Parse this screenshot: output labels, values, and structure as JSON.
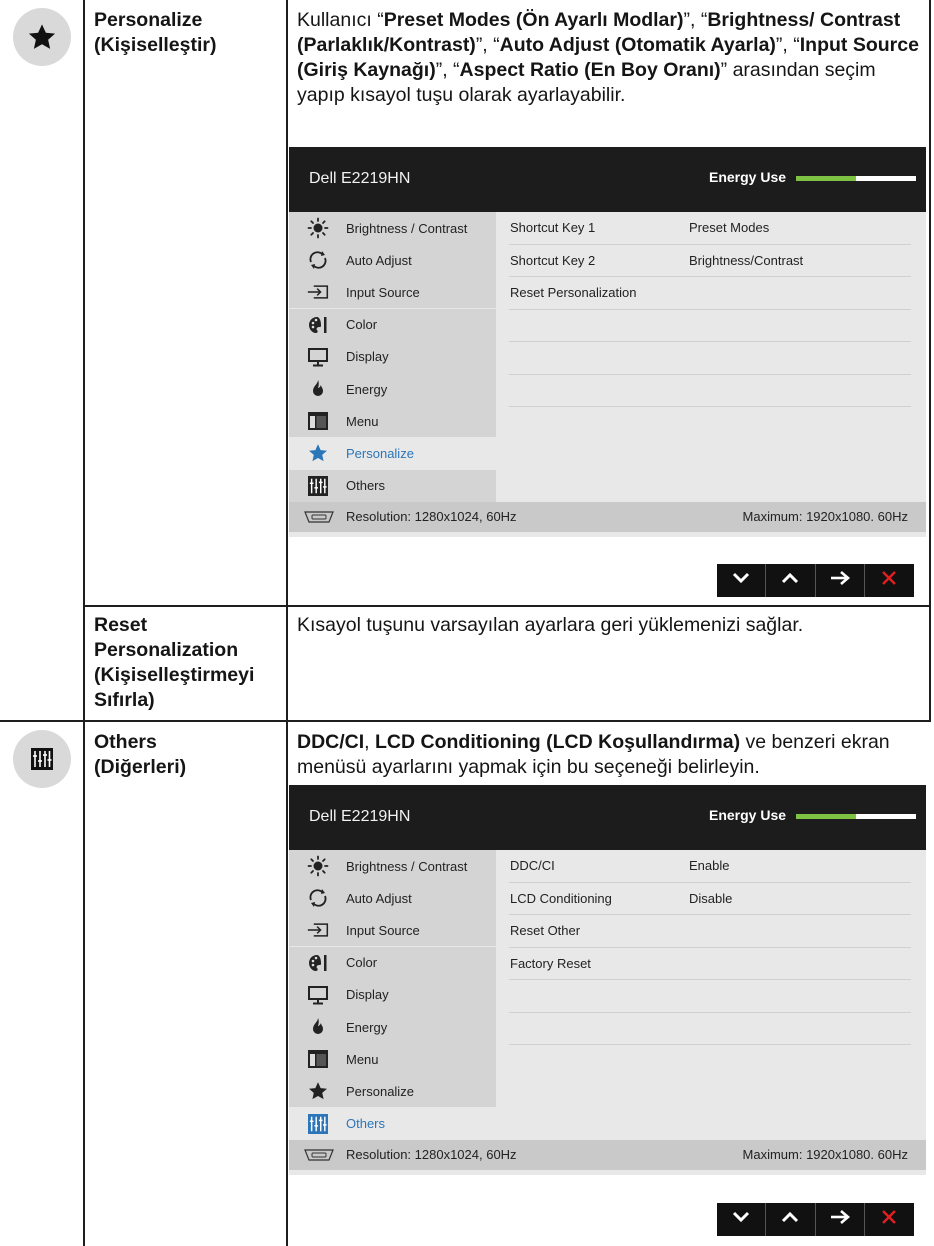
{
  "sections": [
    {
      "label_line1": "Personalize",
      "label_line2": "(Kişiselleştir)",
      "desc_parts": {
        "p1": "Kullanıcı “",
        "b1": "Preset Modes (Ön Ayarlı Modlar)",
        "p2": "”, “",
        "b2": "Brightness/ Contrast (Parlaklık/Kontrast)",
        "p3": "”, “",
        "b3": "Auto Adjust (Otomatik Ayarla)",
        "p4": "”, “",
        "b4": "Input Source (Giriş Kaynağı)",
        "p5": "”, “",
        "b5": "Aspect Ratio (En Boy Oranı)",
        "p6": "” arasından seçim yapıp kısayol tuşu olarak ayarlayabilir."
      },
      "osd": {
        "model": "Dell E2219HN",
        "energy_label": "Energy Use",
        "energy_level": 0.5,
        "menu": [
          "Brightness / Contrast",
          "Auto Adjust",
          "Input Source",
          "Color",
          "Display",
          "Energy",
          "Menu",
          "Personalize",
          "Others"
        ],
        "active_index": 7,
        "rows": [
          {
            "key": "Shortcut Key 1",
            "value": "Preset Modes"
          },
          {
            "key": "Shortcut Key 2",
            "value": "Brightness/Contrast"
          },
          {
            "key": "Reset Personalization",
            "value": ""
          }
        ],
        "footer_left": "Resolution: 1280x1024, 60Hz",
        "footer_right": "Maximum: 1920x1080. 60Hz"
      }
    },
    {
      "label_line1": "Reset",
      "label_line2": "Personalization",
      "label_line3": "(Kişiselleştirmeyi",
      "label_line4": "Sıfırla)",
      "desc": "Kısayol tuşunu varsayılan ayarlara geri yüklemenizi sağlar."
    },
    {
      "label_line1": "Others",
      "label_line2": "(Diğerleri)",
      "desc_parts": {
        "b1": "DDC/CI",
        "p1": ", ",
        "b2": "LCD Conditioning (LCD Koşullandırma)",
        "p2": " ve benzeri ekran menüsü ayarlarını yapmak için bu seçeneği belirleyin."
      },
      "osd": {
        "model": "Dell E2219HN",
        "energy_label": "Energy Use",
        "energy_level": 0.5,
        "menu": [
          "Brightness / Contrast",
          "Auto Adjust",
          "Input Source",
          "Color",
          "Display",
          "Energy",
          "Menu",
          "Personalize",
          "Others"
        ],
        "active_index": 8,
        "rows": [
          {
            "key": "DDC/CI",
            "value": "Enable"
          },
          {
            "key": "LCD Conditioning",
            "value": "Disable"
          },
          {
            "key": "Reset Other",
            "value": ""
          },
          {
            "key": "Factory Reset",
            "value": ""
          }
        ],
        "footer_left": "Resolution: 1280x1024, 60Hz",
        "footer_right": "Maximum: 1920x1080. 60Hz"
      }
    }
  ],
  "colors": {
    "osd_header": "#1c1c1c",
    "energy_bar": "#7dc242",
    "active_menu_text": "#2b76b9",
    "close_icon": "#e02020"
  },
  "icons": {
    "personalize_section": "star-icon",
    "others_section": "others-sliders-icon",
    "nav": [
      "chevron-down-icon",
      "chevron-up-icon",
      "arrow-right-icon",
      "close-icon"
    ]
  }
}
